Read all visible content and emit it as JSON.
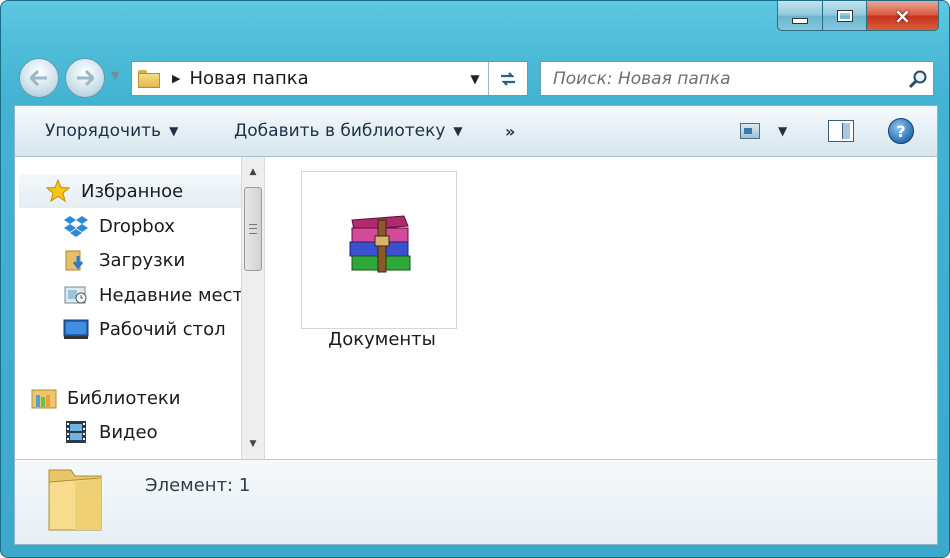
{
  "window": {
    "caption_buttons": {
      "minimize": "minimize",
      "maximize": "maximize",
      "close": "×"
    }
  },
  "address_bar": {
    "path": "Новая папка"
  },
  "search": {
    "placeholder": "Поиск: Новая папка"
  },
  "toolbar": {
    "organize_label": "Упорядочить",
    "add_library_label": "Добавить в библиотеку",
    "more_label": "»"
  },
  "nav_pane": {
    "favorites_label": "Избранное",
    "favorites": [
      {
        "label": "Dropbox",
        "icon": "dropbox-icon"
      },
      {
        "label": "Загрузки",
        "icon": "downloads-folder-icon"
      },
      {
        "label": "Недавние места",
        "icon": "recent-places-icon"
      },
      {
        "label": "Рабочий стол",
        "icon": "desktop-icon"
      }
    ],
    "libraries_label": "Библиотеки",
    "libraries": [
      {
        "label": "Видео",
        "icon": "video-library-icon"
      }
    ]
  },
  "files": [
    {
      "name": "Документы",
      "icon": "winrar-archive-icon"
    }
  ],
  "details": {
    "item_count": "Элемент: 1"
  },
  "colors": {
    "frame": "#42b3d3",
    "close_button": "#d34a2e",
    "toolbar_text": "#1e3246"
  }
}
